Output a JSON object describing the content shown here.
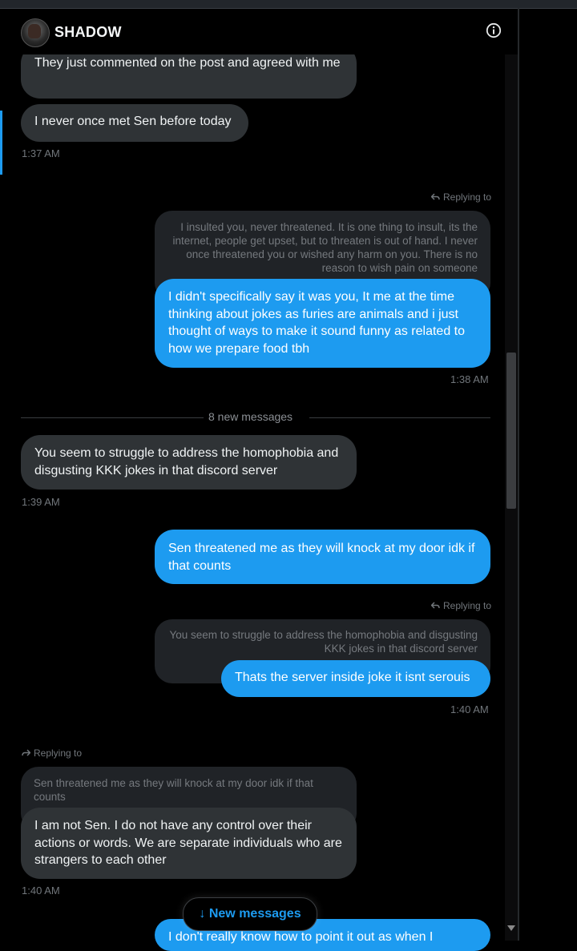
{
  "header": {
    "name": "SHADOW",
    "info_icon": "info-circle-icon",
    "avatar_icon": "avatar-image"
  },
  "messages": {
    "m1": "They just commented on the post and agreed with me",
    "m2": "I never once met Sen before today",
    "t1": "1:37 AM",
    "replying1": "Replying to",
    "quote1": "I insulted you, never threatened. It is one thing to insult, its the internet, people get upset, but to threaten is out of hand. I never once threatened you or wished any harm on you. There is no reason to wish pain on someone",
    "m3": "I didn't specifically say it was you, It me at the time thinking about jokes as furies are animals and i just thought of ways to make it sound funny  as related to how we prepare food tbh",
    "t2": "1:38 AM",
    "new_divider": "8 new messages",
    "m4": "You seem to struggle to address the homophobia and disgusting KKK jokes in that discord server",
    "t3": "1:39 AM",
    "m5": "Sen threatened me as they will knock at my door idk if that counts",
    "replying2": "Replying to",
    "quote2": "You seem to struggle to address the homophobia and disgusting KKK jokes in that discord server",
    "m6": "Thats the server inside joke it isnt serouis",
    "t4": "1:40 AM",
    "replying3": "Replying to",
    "quote3": "Sen threatened me as they will knock at my door idk if that counts",
    "m7": "I am not Sen. I do not have any control over their actions or words. We are separate individuals who are strangers to each other",
    "t5": "1:40 AM",
    "m8": "I don't really know how to point it out as when I"
  },
  "new_messages_button": "↓ New messages",
  "colors": {
    "outgoing": "#1d9bf0",
    "incoming": "#2f3336",
    "background": "#000000"
  }
}
